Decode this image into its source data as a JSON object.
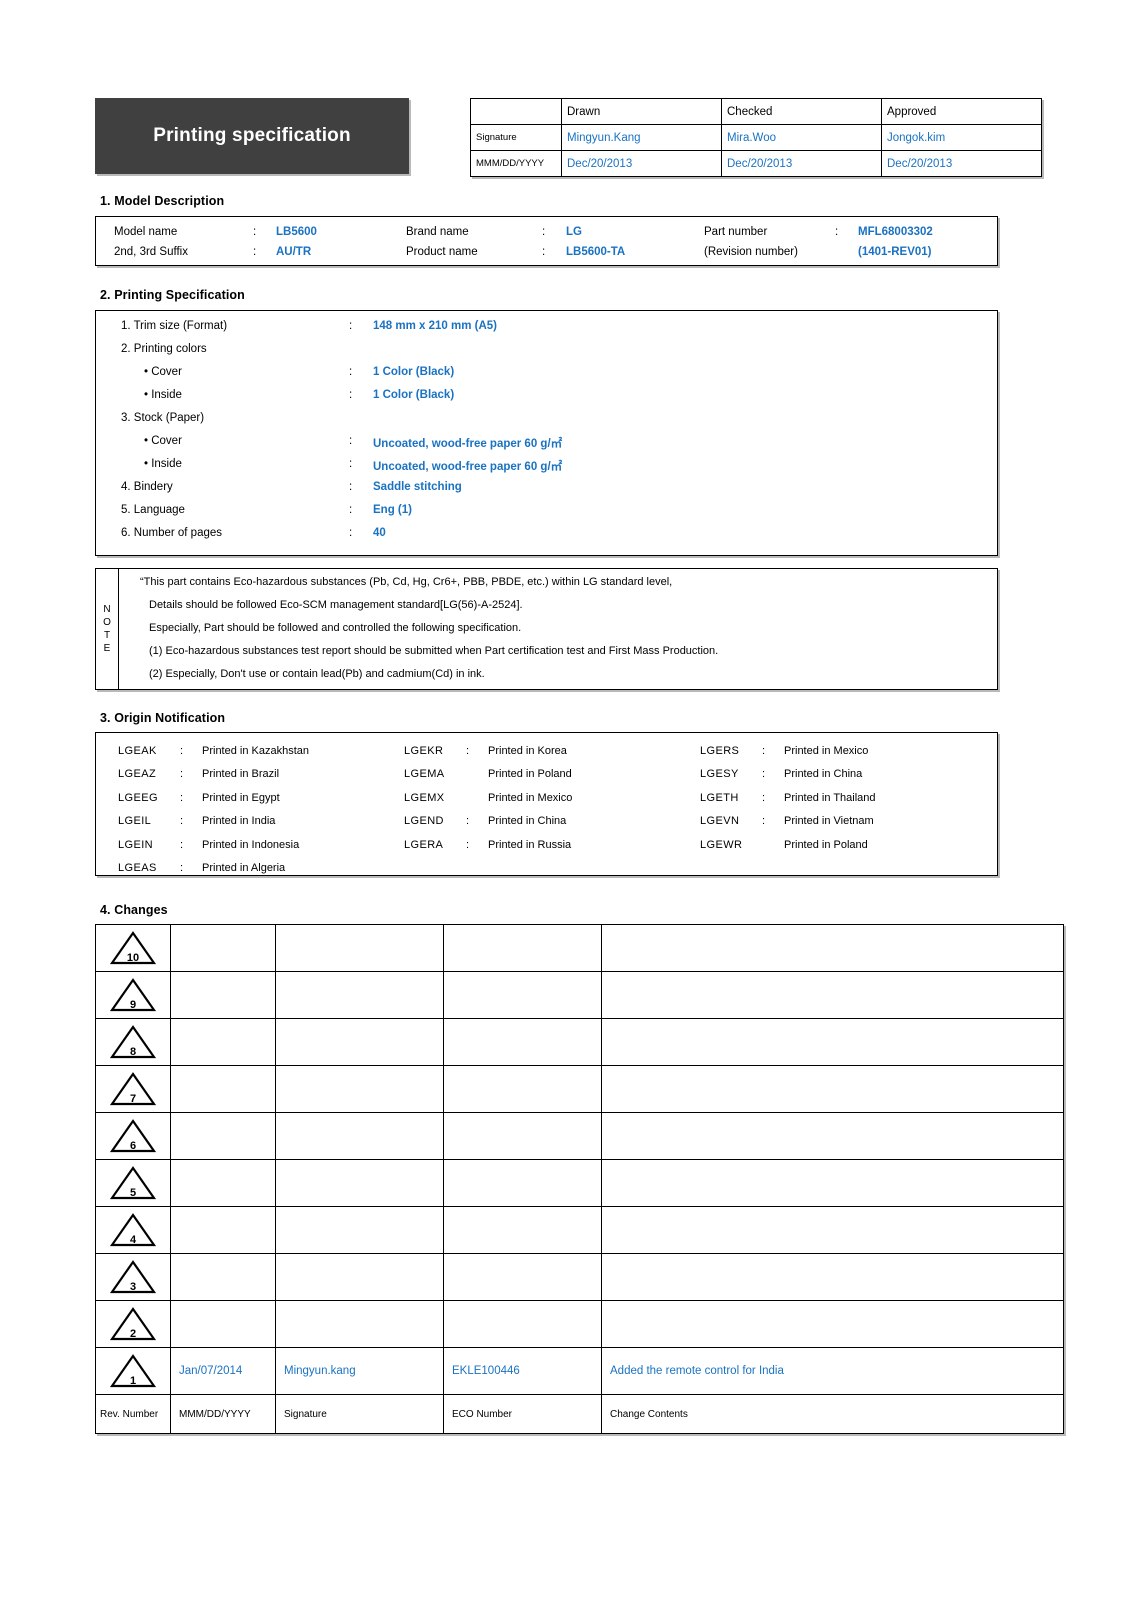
{
  "header": {
    "title": "Printing specification",
    "approval": {
      "columns": [
        "",
        "Drawn",
        "Checked",
        "Approved"
      ],
      "rows": [
        {
          "label": "Signature",
          "values": [
            "Mingyun.Kang",
            "Mira.Woo",
            "Jongok.kim"
          ]
        },
        {
          "label": "MMM/DD/YYYY",
          "values": [
            "Dec/20/2013",
            "Dec/20/2013",
            "Dec/20/2013"
          ]
        }
      ]
    }
  },
  "section1": {
    "heading": "1. Model Description",
    "fields": [
      {
        "label": "Model name",
        "colon": ":",
        "value": "LB5600"
      },
      {
        "label": "Brand name",
        "colon": ":",
        "value": "LG"
      },
      {
        "label": "Part number",
        "colon": ":",
        "value": "MFL68003302"
      },
      {
        "label": "2nd, 3rd Suffix",
        "colon": ":",
        "value": "AU/TR"
      },
      {
        "label": "Product name",
        "colon": ":",
        "value": "LB5600-TA"
      },
      {
        "label": "(Revision number)",
        "colon": "",
        "value": "(1401-REV01)"
      }
    ]
  },
  "section2": {
    "heading": "2. Printing Specification",
    "items": [
      {
        "label": "1. Trim size (Format)",
        "colon": ":",
        "value": "148 mm x 210 mm (A5)",
        "indent": false
      },
      {
        "label": "2. Printing colors",
        "colon": "",
        "value": "",
        "indent": false
      },
      {
        "label": "• Cover",
        "colon": ":",
        "value": "1 Color (Black)",
        "indent": true
      },
      {
        "label": "• Inside",
        "colon": ":",
        "value": "1 Color (Black)",
        "indent": true
      },
      {
        "label": "3. Stock (Paper)",
        "colon": "",
        "value": "",
        "indent": false
      },
      {
        "label": "• Cover",
        "colon": ":",
        "value": "Uncoated, wood-free paper 60 g/㎡",
        "indent": true
      },
      {
        "label": "• Inside",
        "colon": ":",
        "value": "Uncoated, wood-free paper 60 g/㎡",
        "indent": true
      },
      {
        "label": "4. Bindery",
        "colon": ":",
        "value": "Saddle stitching",
        "indent": false
      },
      {
        "label": "5. Language",
        "colon": ":",
        "value": "Eng (1)",
        "indent": false
      },
      {
        "label": "6. Number of pages",
        "colon": ":",
        "value": "40",
        "indent": false
      }
    ]
  },
  "note": {
    "side_label": "NOTE",
    "side_letters": [
      "N",
      "O",
      "T",
      "E"
    ],
    "lines": [
      "“This part contains Eco-hazardous substances (Pb, Cd, Hg, Cr6+, PBB, PBDE, etc.) within LG standard level,",
      "Details should be followed Eco-SCM management standard[LG(56)-A-2524].",
      "Especially, Part should be followed and controlled the following specification.",
      "(1) Eco-hazardous substances test report should be submitted when Part certification test and First Mass Production.",
      "(2) Especially, Don't use or contain lead(Pb) and cadmium(Cd) in ink."
    ]
  },
  "section3": {
    "heading": "3. Origin Notification",
    "columns": [
      [
        {
          "code": "LGEAK",
          "colon": ":",
          "country": "Printed in Kazakhstan"
        },
        {
          "code": "LGEAZ",
          "colon": ":",
          "country": "Printed in Brazil"
        },
        {
          "code": "LGEEG",
          "colon": ":",
          "country": "Printed in Egypt"
        },
        {
          "code": "LGEIL",
          "colon": ":",
          "country": "Printed in India"
        },
        {
          "code": "LGEIN",
          "colon": ":",
          "country": "Printed in Indonesia"
        },
        {
          "code": "LGEAS",
          "colon": ":",
          "country": "Printed in Algeria"
        }
      ],
      [
        {
          "code": "LGEKR",
          "colon": ":",
          "country": "Printed in Korea"
        },
        {
          "code": "LGEMA",
          "colon": "",
          "country": "Printed in Poland"
        },
        {
          "code": "LGEMX",
          "colon": "",
          "country": "Printed in Mexico"
        },
        {
          "code": "LGEND",
          "colon": ":",
          "country": "Printed in China"
        },
        {
          "code": "LGERA",
          "colon": ":",
          "country": "Printed in Russia"
        }
      ],
      [
        {
          "code": "LGERS",
          "colon": ":",
          "country": "Printed in Mexico"
        },
        {
          "code": "LGESY",
          "colon": ":",
          "country": "Printed in China"
        },
        {
          "code": "LGETH",
          "colon": ":",
          "country": "Printed in Thailand"
        },
        {
          "code": "LGEVN",
          "colon": ":",
          "country": "Printed in Vietnam"
        },
        {
          "code": "LGEWR",
          "colon": "",
          "country": "Printed in Poland"
        }
      ]
    ]
  },
  "section4": {
    "heading": "4. Changes",
    "rows": [
      {
        "rev": "10",
        "date": "",
        "signature": "",
        "eco": "",
        "change": ""
      },
      {
        "rev": "9",
        "date": "",
        "signature": "",
        "eco": "",
        "change": ""
      },
      {
        "rev": "8",
        "date": "",
        "signature": "",
        "eco": "",
        "change": ""
      },
      {
        "rev": "7",
        "date": "",
        "signature": "",
        "eco": "",
        "change": ""
      },
      {
        "rev": "6",
        "date": "",
        "signature": "",
        "eco": "",
        "change": ""
      },
      {
        "rev": "5",
        "date": "",
        "signature": "",
        "eco": "",
        "change": ""
      },
      {
        "rev": "4",
        "date": "",
        "signature": "",
        "eco": "",
        "change": ""
      },
      {
        "rev": "3",
        "date": "",
        "signature": "",
        "eco": "",
        "change": ""
      },
      {
        "rev": "2",
        "date": "",
        "signature": "",
        "eco": "",
        "change": ""
      },
      {
        "rev": "1",
        "date": "Jan/07/2014",
        "signature": "Mingyun.kang",
        "eco": "EKLE100446",
        "change": "Added the remote control for India"
      }
    ],
    "footer": {
      "rev": "Rev. Number",
      "date": "MMM/DD/YYYY",
      "signature": "Signature",
      "eco": "ECO Number",
      "change": "Change Contents"
    }
  },
  "colors": {
    "banner_bg": "#404040",
    "accent_blue": "#1a72c2",
    "text": "#000000"
  }
}
